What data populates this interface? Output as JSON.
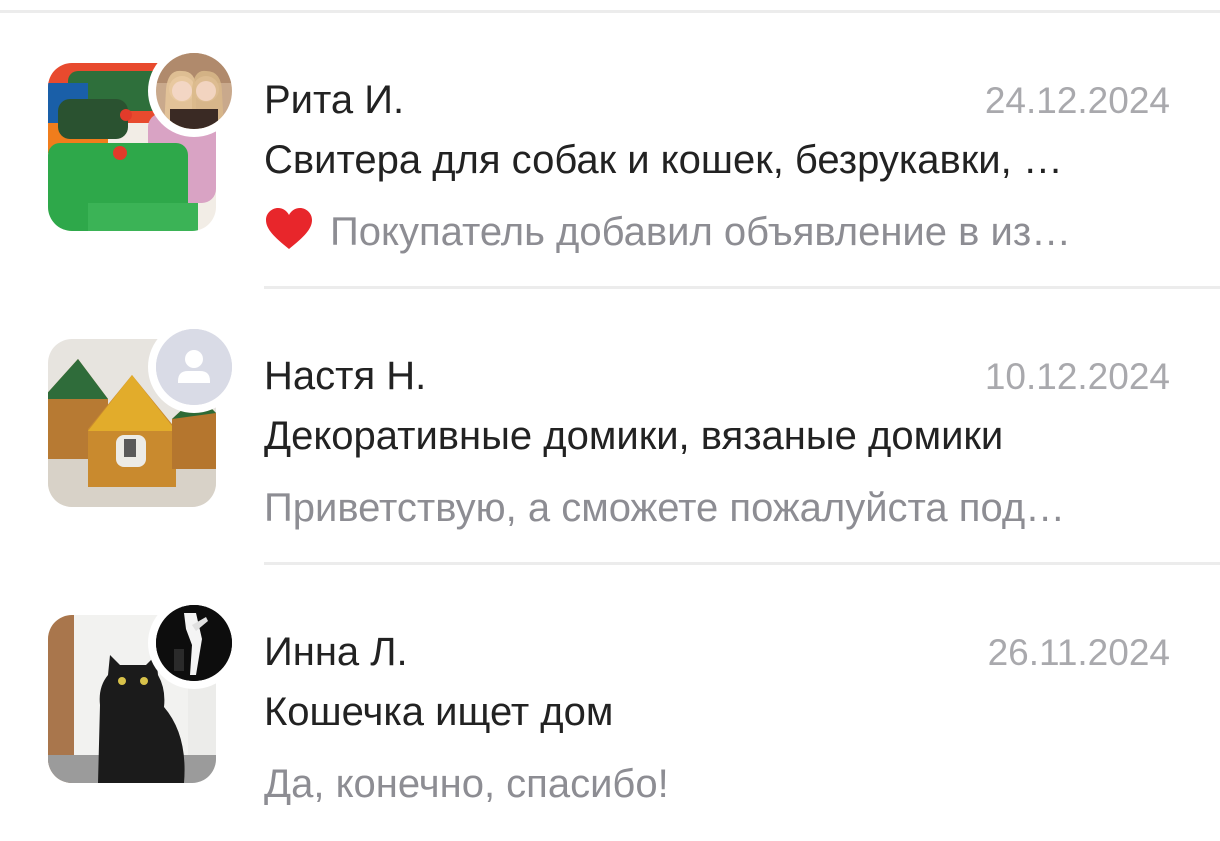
{
  "chats": [
    {
      "name": "Рита И.",
      "date": "24.12.2024",
      "ad_title": "Свитера для собак и кошек, безрукавки, …",
      "preview": "Покупатель добавил объявление в из…",
      "preview_icon": "heart-icon",
      "thumb": "knitted-sweaters-photo",
      "avatar": "two-girls-photo"
    },
    {
      "name": "Настя Н.",
      "date": "10.12.2024",
      "ad_title": "Декоративные домики, вязаные домики",
      "preview": "Приветствую, а сможете пожалуйста под…",
      "thumb": "knitted-houses-photo",
      "avatar": "default-user-icon"
    },
    {
      "name": "Инна Л.",
      "date": "26.11.2024",
      "ad_title": "Кошечка ищет дом",
      "preview": "Да, конечно, спасибо!",
      "thumb": "black-cat-photo",
      "avatar": "dark-figure-photo"
    }
  ],
  "colors": {
    "name_text": "#222222",
    "date_text": "#a9a9ad",
    "preview_text": "#8d8d93",
    "divider": "#ececec",
    "heart": "#e8262b"
  }
}
